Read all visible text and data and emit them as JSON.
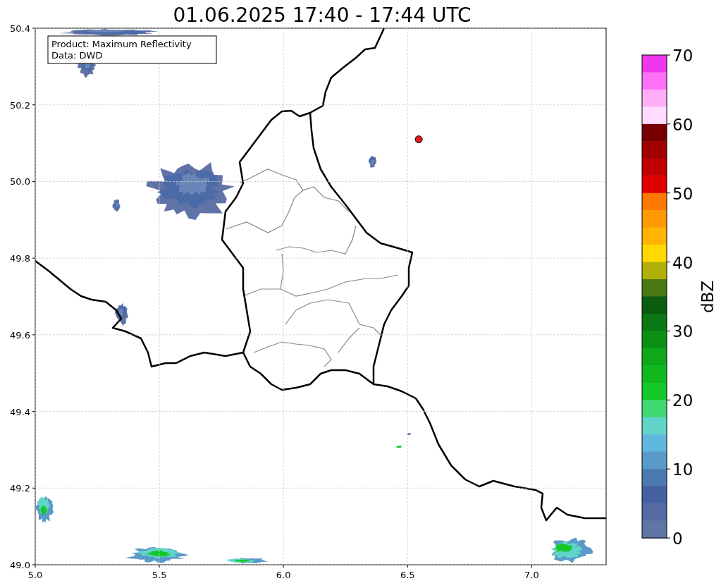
{
  "figure": {
    "title": "01.06.2025 17:40 - 17:44 UTC",
    "info_box": [
      "Product: Maximum Reflectivity",
      "Data: DWD"
    ],
    "chart_data": {
      "type": "scatter",
      "grid": true,
      "xlim": [
        5.0,
        7.3
      ],
      "ylim": [
        49.0,
        50.4
      ],
      "xticks": [
        {
          "value": 5.0,
          "label": "5.0"
        },
        {
          "value": 5.5,
          "label": "5.5"
        },
        {
          "value": 6.0,
          "label": "6.0"
        },
        {
          "value": 6.5,
          "label": "6.5"
        },
        {
          "value": 7.0,
          "label": "7.0"
        }
      ],
      "yticks": [
        {
          "value": 49.0,
          "label": "49.0"
        },
        {
          "value": 49.2,
          "label": "49.2"
        },
        {
          "value": 49.4,
          "label": "49.4"
        },
        {
          "value": 49.6,
          "label": "49.6"
        },
        {
          "value": 49.8,
          "label": "49.8"
        },
        {
          "value": 50.0,
          "label": "50.0"
        },
        {
          "value": 50.2,
          "label": "50.2"
        },
        {
          "value": 50.4,
          "label": "50.4"
        }
      ],
      "x": [
        6.545
      ],
      "series": [
        {
          "color": "#e31a1c",
          "values": [
            50.11
          ]
        }
      ]
    },
    "colorbar": {
      "label": "dBZ",
      "ticks": [
        "70",
        "60",
        "50",
        "40",
        "30",
        "20",
        "10",
        "0"
      ],
      "segments": [
        {
          "color": "#ee38ee"
        },
        {
          "color": "#ff70f8"
        },
        {
          "color": "#ffaef8"
        },
        {
          "color": "#ffdcff"
        },
        {
          "color": "#780000"
        },
        {
          "color": "#a00000"
        },
        {
          "color": "#c00000"
        },
        {
          "color": "#e00000"
        },
        {
          "color": "#ff7800"
        },
        {
          "color": "#ff9a00"
        },
        {
          "color": "#ffb400"
        },
        {
          "color": "#ffd800"
        },
        {
          "color": "#b0b008"
        },
        {
          "color": "#487810"
        },
        {
          "color": "#0a5c10"
        },
        {
          "color": "#0a7814"
        },
        {
          "color": "#0b8f14"
        },
        {
          "color": "#0ea81a"
        },
        {
          "color": "#10b820"
        },
        {
          "color": "#14c828"
        },
        {
          "color": "#40d870"
        },
        {
          "color": "#60d4c8"
        },
        {
          "color": "#60b8dc"
        },
        {
          "color": "#5a9ac8"
        },
        {
          "color": "#4b7ab0"
        },
        {
          "color": "#4460a0"
        },
        {
          "color": "#566aa3"
        },
        {
          "color": "#6074a8"
        }
      ]
    }
  }
}
